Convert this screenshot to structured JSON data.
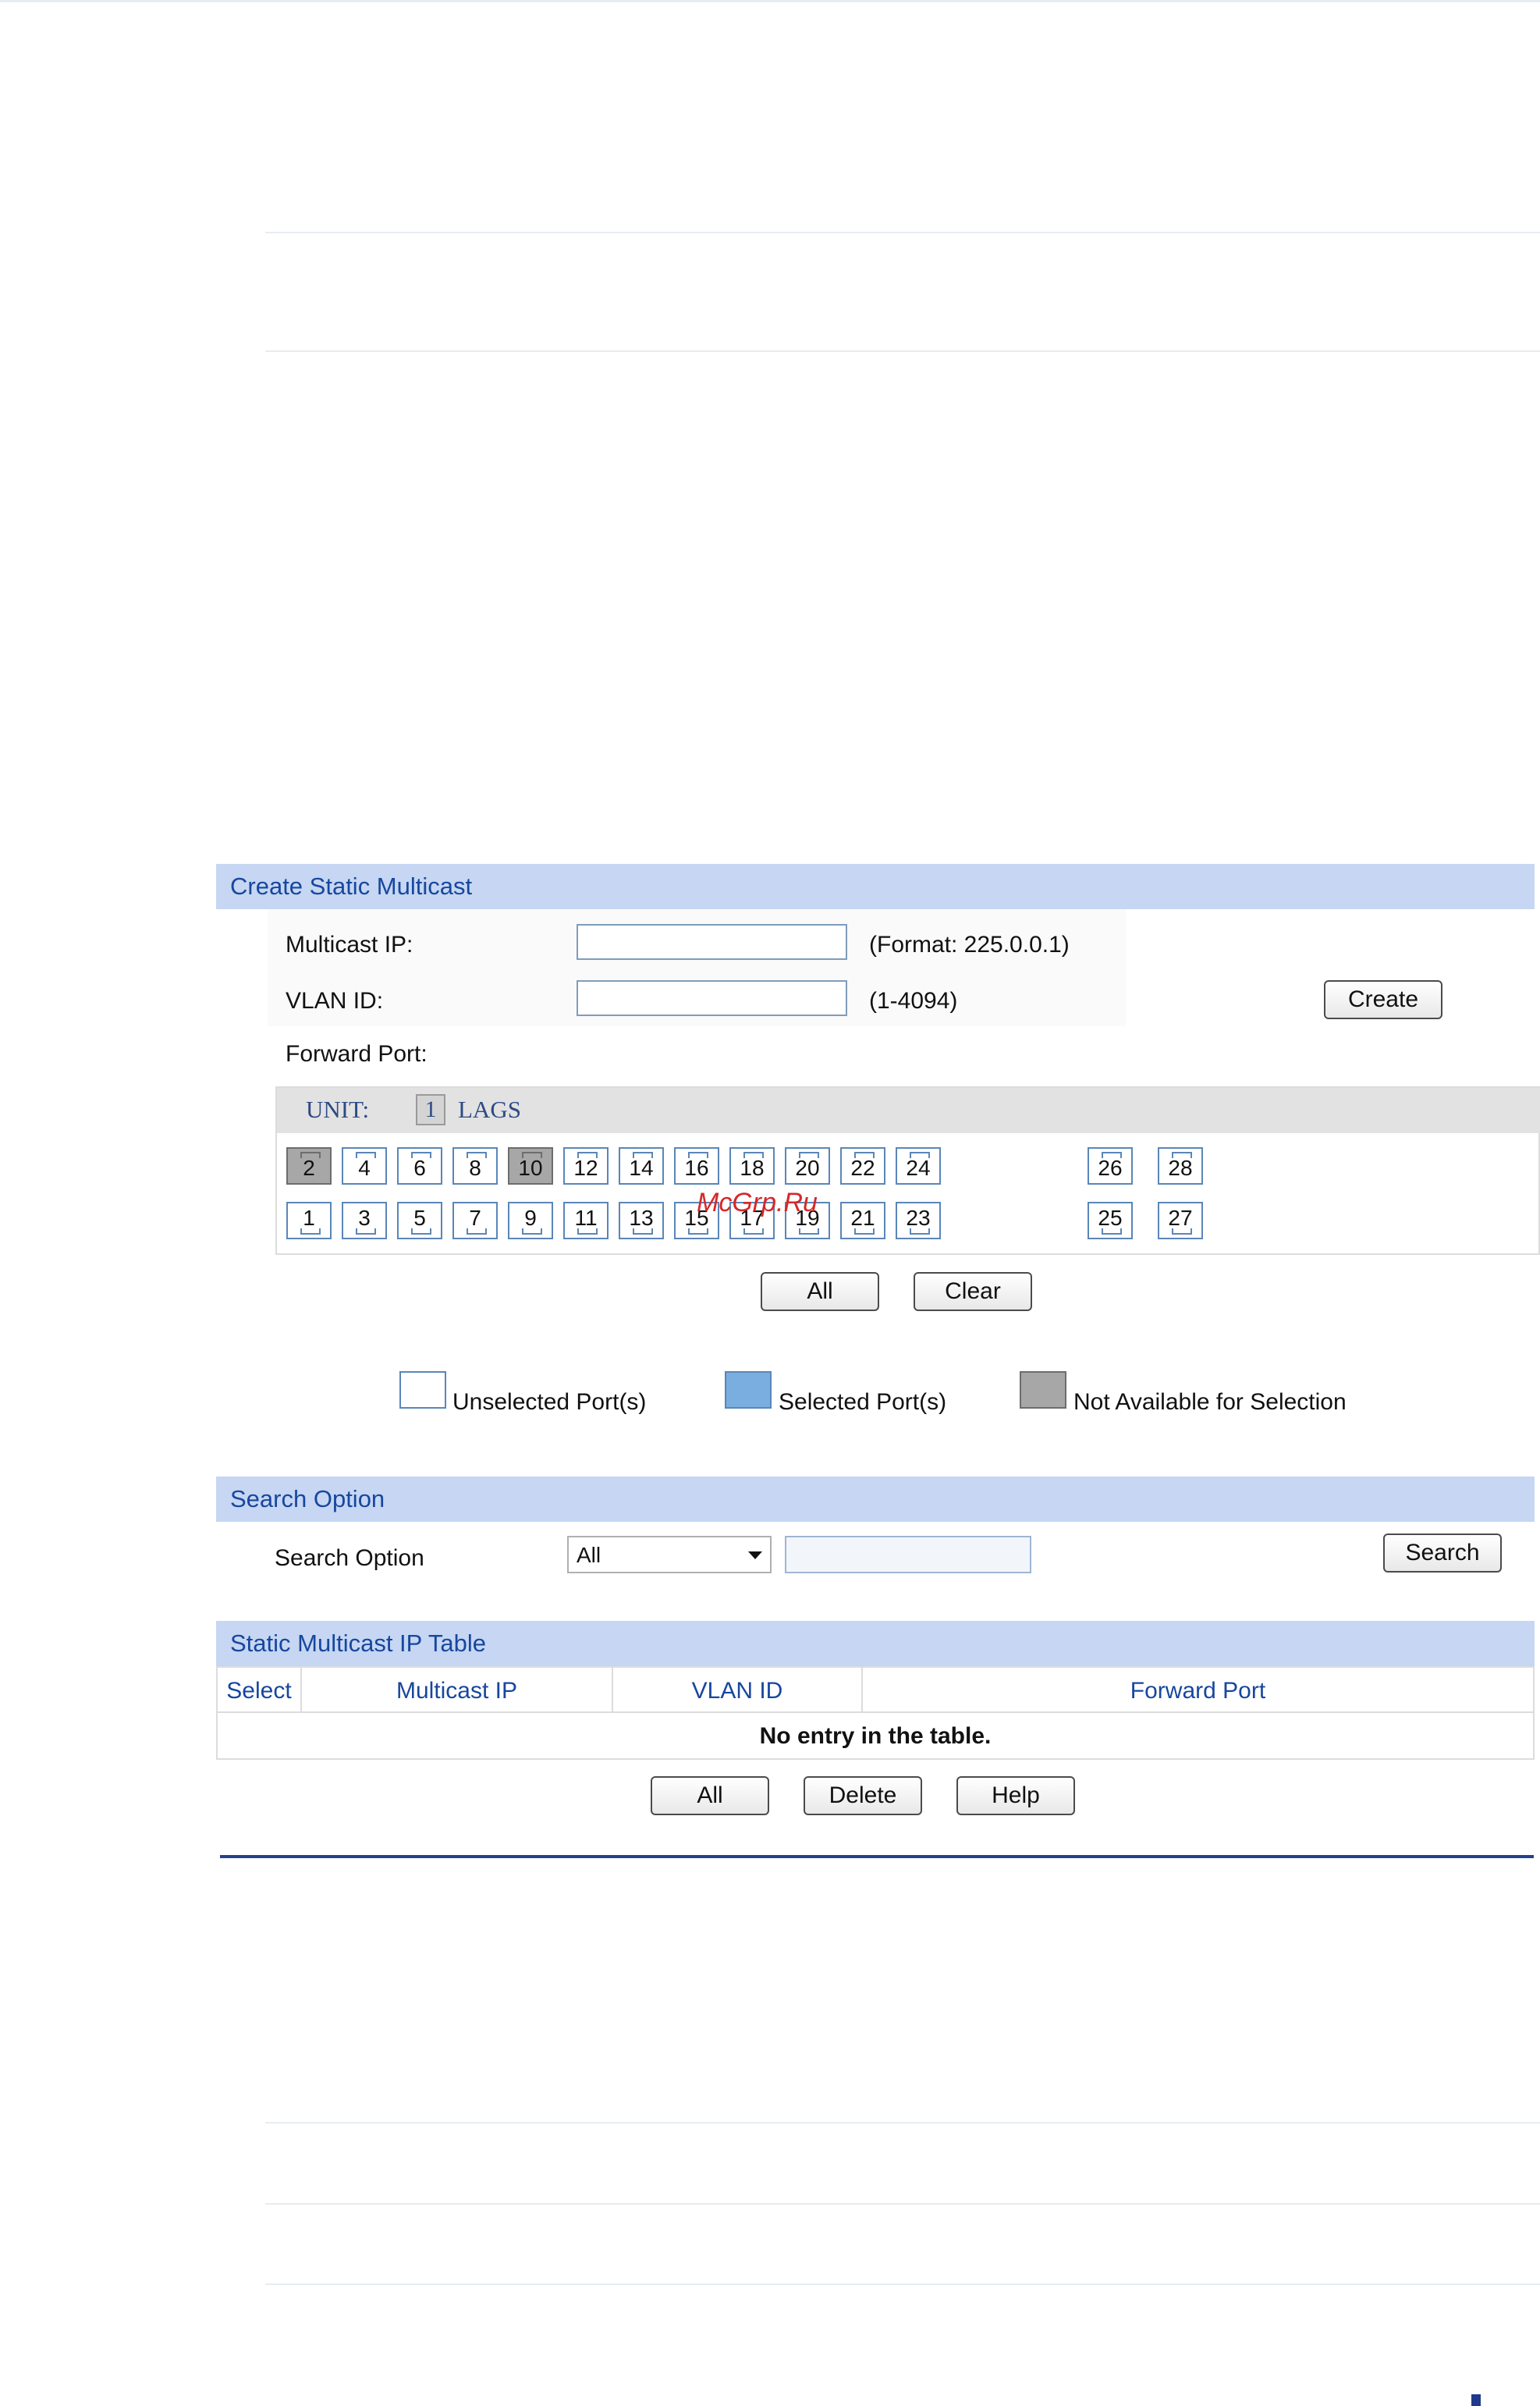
{
  "create": {
    "title": "Create Static Multicast",
    "multicast_ip_label": "Multicast IP:",
    "multicast_ip_value": "",
    "multicast_ip_hint": "(Format: 225.0.0.1)",
    "vlan_id_label": "VLAN ID:",
    "vlan_id_value": "",
    "vlan_id_hint": "(1-4094)",
    "create_button": "Create",
    "forward_port_label": "Forward Port:",
    "unit_label": "UNIT:",
    "unit_number": "1",
    "lags_label": "LAGS",
    "ports_top": [
      "2",
      "4",
      "6",
      "8",
      "10",
      "12",
      "14",
      "16",
      "18",
      "20",
      "22",
      "24",
      "26",
      "28"
    ],
    "ports_bottom": [
      "1",
      "3",
      "5",
      "7",
      "9",
      "11",
      "13",
      "15",
      "17",
      "19",
      "21",
      "23",
      "25",
      "27"
    ],
    "not_available_ports": [
      "2",
      "10"
    ],
    "all_button": "All",
    "clear_button": "Clear",
    "watermark": "McGrp.Ru"
  },
  "legend": {
    "unselected": "Unselected Port(s)",
    "selected": "Selected Port(s)",
    "not_available": "Not Available for Selection"
  },
  "search": {
    "title": "Search Option",
    "label": "Search Option",
    "select_value": "All",
    "input_value": "",
    "search_button": "Search"
  },
  "table": {
    "title": "Static Multicast IP Table",
    "columns": [
      "Select",
      "Multicast IP",
      "VLAN ID",
      "Forward Port"
    ],
    "empty_message": "No entry in the table.",
    "all_button": "All",
    "delete_button": "Delete",
    "help_button": "Help"
  },
  "colors": {
    "section_bar": "#c6d6f3",
    "section_text": "#17479e",
    "port_border": "#5a86b8",
    "not_available": "#a7a7a7",
    "selected": "#7aaee0"
  }
}
